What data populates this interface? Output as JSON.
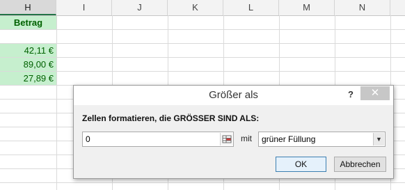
{
  "sheet": {
    "columns": [
      "H",
      "I",
      "J",
      "K",
      "L",
      "M",
      "N"
    ],
    "header_cell": "Betrag",
    "amounts": [
      "42,11 €",
      "89,00 €",
      "27,89 €"
    ],
    "highlight_color": "#c6efce",
    "highlight_text_color": "#006100"
  },
  "dialog": {
    "title": "Größer als",
    "help_label": "?",
    "close_label": "✕",
    "prompt": "Zellen formatieren, die GRÖSSER SIND ALS:",
    "value": "0",
    "connector": "mit",
    "format_option": "grüner Füllung",
    "ok_label": "OK",
    "cancel_label": "Abbrechen"
  }
}
